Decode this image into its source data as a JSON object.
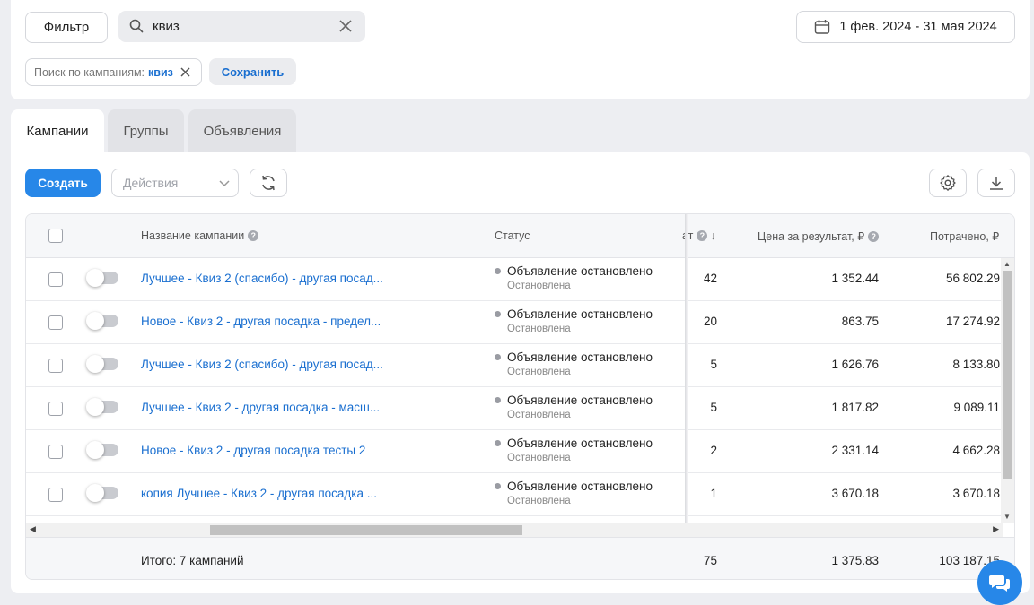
{
  "toolbar": {
    "filter_label": "Фильтр",
    "search_value": "квиз",
    "date_range": "1 фев. 2024 - 31 мая 2024"
  },
  "filter_chip": {
    "prefix": "Поиск по кампаниям:",
    "query": "квиз"
  },
  "save_label": "Сохранить",
  "tabs": [
    {
      "label": "Кампании",
      "active": true
    },
    {
      "label": "Группы",
      "active": false
    },
    {
      "label": "Объявления",
      "active": false
    }
  ],
  "actions": {
    "create_label": "Создать",
    "actions_placeholder": "Действия"
  },
  "table": {
    "columns": {
      "name": "Название кампании",
      "status": "Статус",
      "results": "ат",
      "cost_per_result": "Цена за результат, ₽",
      "spent": "Потрачено, ₽"
    },
    "rows": [
      {
        "name": "Лучшее - Квиз 2 (спасибо) - другая посад...",
        "status": "Объявление остановлено",
        "substatus": "Остановлена",
        "results": "42",
        "cost": "1 352.44",
        "spent": "56 802.29"
      },
      {
        "name": "Новое - Квиз 2 - другая посадка - предел...",
        "status": "Объявление остановлено",
        "substatus": "Остановлена",
        "results": "20",
        "cost": "863.75",
        "spent": "17 274.92"
      },
      {
        "name": "Лучшее - Квиз 2 (спасибо) - другая посад...",
        "status": "Объявление остановлено",
        "substatus": "Остановлена",
        "results": "5",
        "cost": "1 626.76",
        "spent": "8 133.80"
      },
      {
        "name": "Лучшее - Квиз 2 - другая посадка - масш...",
        "status": "Объявление остановлено",
        "substatus": "Остановлена",
        "results": "5",
        "cost": "1 817.82",
        "spent": "9 089.11"
      },
      {
        "name": "Новое - Квиз 2 - другая посадка тесты 2",
        "status": "Объявление остановлено",
        "substatus": "Остановлена",
        "results": "2",
        "cost": "2 331.14",
        "spent": "4 662.28"
      },
      {
        "name": "копия Лучшее - Квиз 2 - другая посадка ...",
        "status": "Объявление остановлено",
        "substatus": "Остановлена",
        "results": "1",
        "cost": "3 670.18",
        "spent": "3 670.18"
      }
    ],
    "totals": {
      "label": "Итого: 7 кампаний",
      "results": "75",
      "cost": "1 375.83",
      "spent": "103 187.15"
    }
  }
}
